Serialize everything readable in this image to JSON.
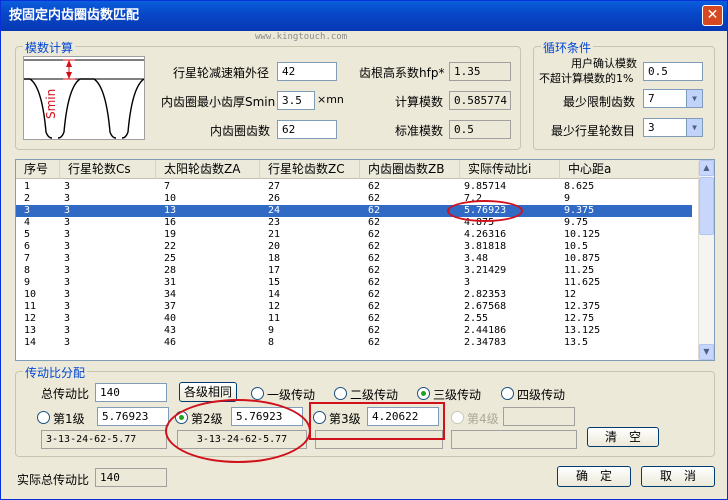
{
  "window": {
    "title": "按固定内齿圈齿数匹配",
    "close_glyph": "✕"
  },
  "watermark": "www.kingtouch.com",
  "module_calc": {
    "title": "模数计算",
    "diagram_label": "Smin",
    "outer_diameter_label": "行星轮减速箱外径",
    "outer_diameter_value": "42",
    "min_thickness_label": "内齿圈最小齿厚Smin",
    "min_thickness_value": "3.5",
    "min_thickness_unit": "×mn",
    "ring_teeth_label": "内齿圈齿数",
    "ring_teeth_value": "62",
    "hfp_label": "齿根高系数hfp*",
    "hfp_value": "1.35",
    "calc_module_label": "计算模数",
    "calc_module_value": "0.585774",
    "std_module_label": "标准模数",
    "std_module_value": "0.5"
  },
  "loop_conditions": {
    "title": "循环条件",
    "confirm_label_line1": "用户确认模数",
    "confirm_label_line2": "不超计算模数的1%",
    "confirm_value": "0.5",
    "min_limit_label": "最少限制齿数",
    "min_limit_value": "7",
    "min_planets_label": "最少行星轮数目",
    "min_planets_value": "3"
  },
  "table": {
    "columns": [
      "序号",
      "行星轮数Cs",
      "太阳轮齿数ZA",
      "行星轮齿数ZC",
      "内齿圈齿数ZB",
      "实际传动比i",
      "中心距a"
    ],
    "rows": [
      [
        "1",
        "3",
        "7",
        "27",
        "62",
        "9.85714",
        "8.625"
      ],
      [
        "2",
        "3",
        "10",
        "26",
        "62",
        "7.2",
        "9"
      ],
      [
        "3",
        "3",
        "13",
        "24",
        "62",
        "5.76923",
        "9.375"
      ],
      [
        "4",
        "3",
        "16",
        "23",
        "62",
        "4.875",
        "9.75"
      ],
      [
        "5",
        "3",
        "19",
        "21",
        "62",
        "4.26316",
        "10.125"
      ],
      [
        "6",
        "3",
        "22",
        "20",
        "62",
        "3.81818",
        "10.5"
      ],
      [
        "7",
        "3",
        "25",
        "18",
        "62",
        "3.48",
        "10.875"
      ],
      [
        "8",
        "3",
        "28",
        "17",
        "62",
        "3.21429",
        "11.25"
      ],
      [
        "9",
        "3",
        "31",
        "15",
        "62",
        "3",
        "11.625"
      ],
      [
        "10",
        "3",
        "34",
        "14",
        "62",
        "2.82353",
        "12"
      ],
      [
        "11",
        "3",
        "37",
        "12",
        "62",
        "2.67568",
        "12.375"
      ],
      [
        "12",
        "3",
        "40",
        "11",
        "62",
        "2.55",
        "12.75"
      ],
      [
        "13",
        "3",
        "43",
        "9",
        "62",
        "2.44186",
        "13.125"
      ],
      [
        "14",
        "3",
        "46",
        "8",
        "62",
        "2.34783",
        "13.5"
      ]
    ],
    "selected_row": 2
  },
  "ratio_dist": {
    "title": "传动比分配",
    "total_ratio_label": "总传动比",
    "total_ratio_value": "140",
    "same_button": "各级相同",
    "stage_options": [
      "一级传动",
      "二级传动",
      "三级传动",
      "四级传动"
    ],
    "stage_selected": 2,
    "levels": [
      {
        "label": "第1级",
        "value": "5.76923",
        "result": "3-13-24-62-5.77"
      },
      {
        "label": "第2级",
        "value": "5.76923",
        "result": "3-13-24-62-5.77"
      },
      {
        "label": "第3级",
        "value": "4.20622",
        "result": ""
      },
      {
        "label": "第4级",
        "value": "",
        "result": ""
      }
    ],
    "clear_button": "清　空"
  },
  "footer": {
    "actual_total_label": "实际总传动比",
    "actual_total_value": "140",
    "ok_button": "确　定",
    "cancel_button": "取　消"
  }
}
